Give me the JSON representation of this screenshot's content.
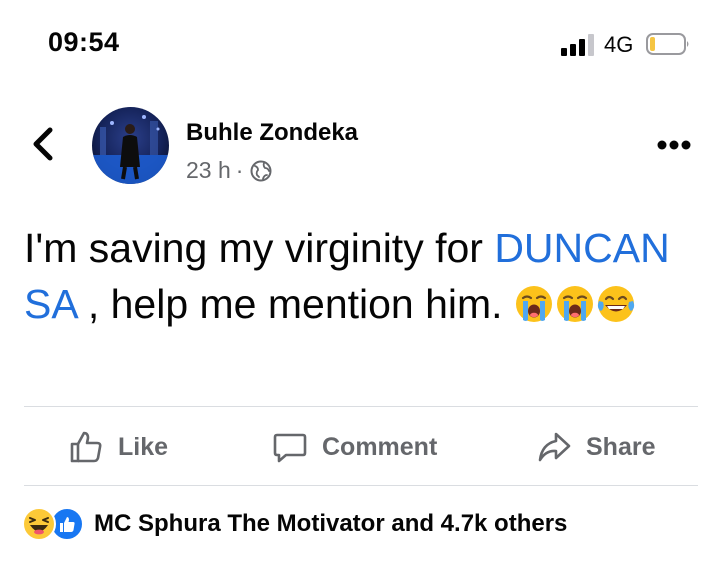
{
  "status_bar": {
    "time": "09:54",
    "network": "4G"
  },
  "post": {
    "author": "Buhle Zondeka",
    "timestamp": "23 h",
    "separator": "·",
    "privacy_icon": "globe-icon",
    "text_before": "I'm saving my virginity for ",
    "mention": "DUNCAN SA",
    "text_after": " , help me mention him.",
    "emojis": [
      "loudly-crying-face",
      "loudly-crying-face",
      "face-with-tears-of-joy"
    ]
  },
  "actions": {
    "like_label": "Like",
    "comment_label": "Comment",
    "share_label": "Share"
  },
  "reactions": {
    "icons": [
      "haha-reaction-icon",
      "like-reaction-icon"
    ],
    "summary": "MC Sphura The Motivator and 4.7k others"
  },
  "colors": {
    "mention": "#216fdb",
    "secondary_text": "#65676b",
    "like_blue": "#1877f2",
    "haha_yellow": "#fcc938",
    "divider": "#dadde1"
  }
}
